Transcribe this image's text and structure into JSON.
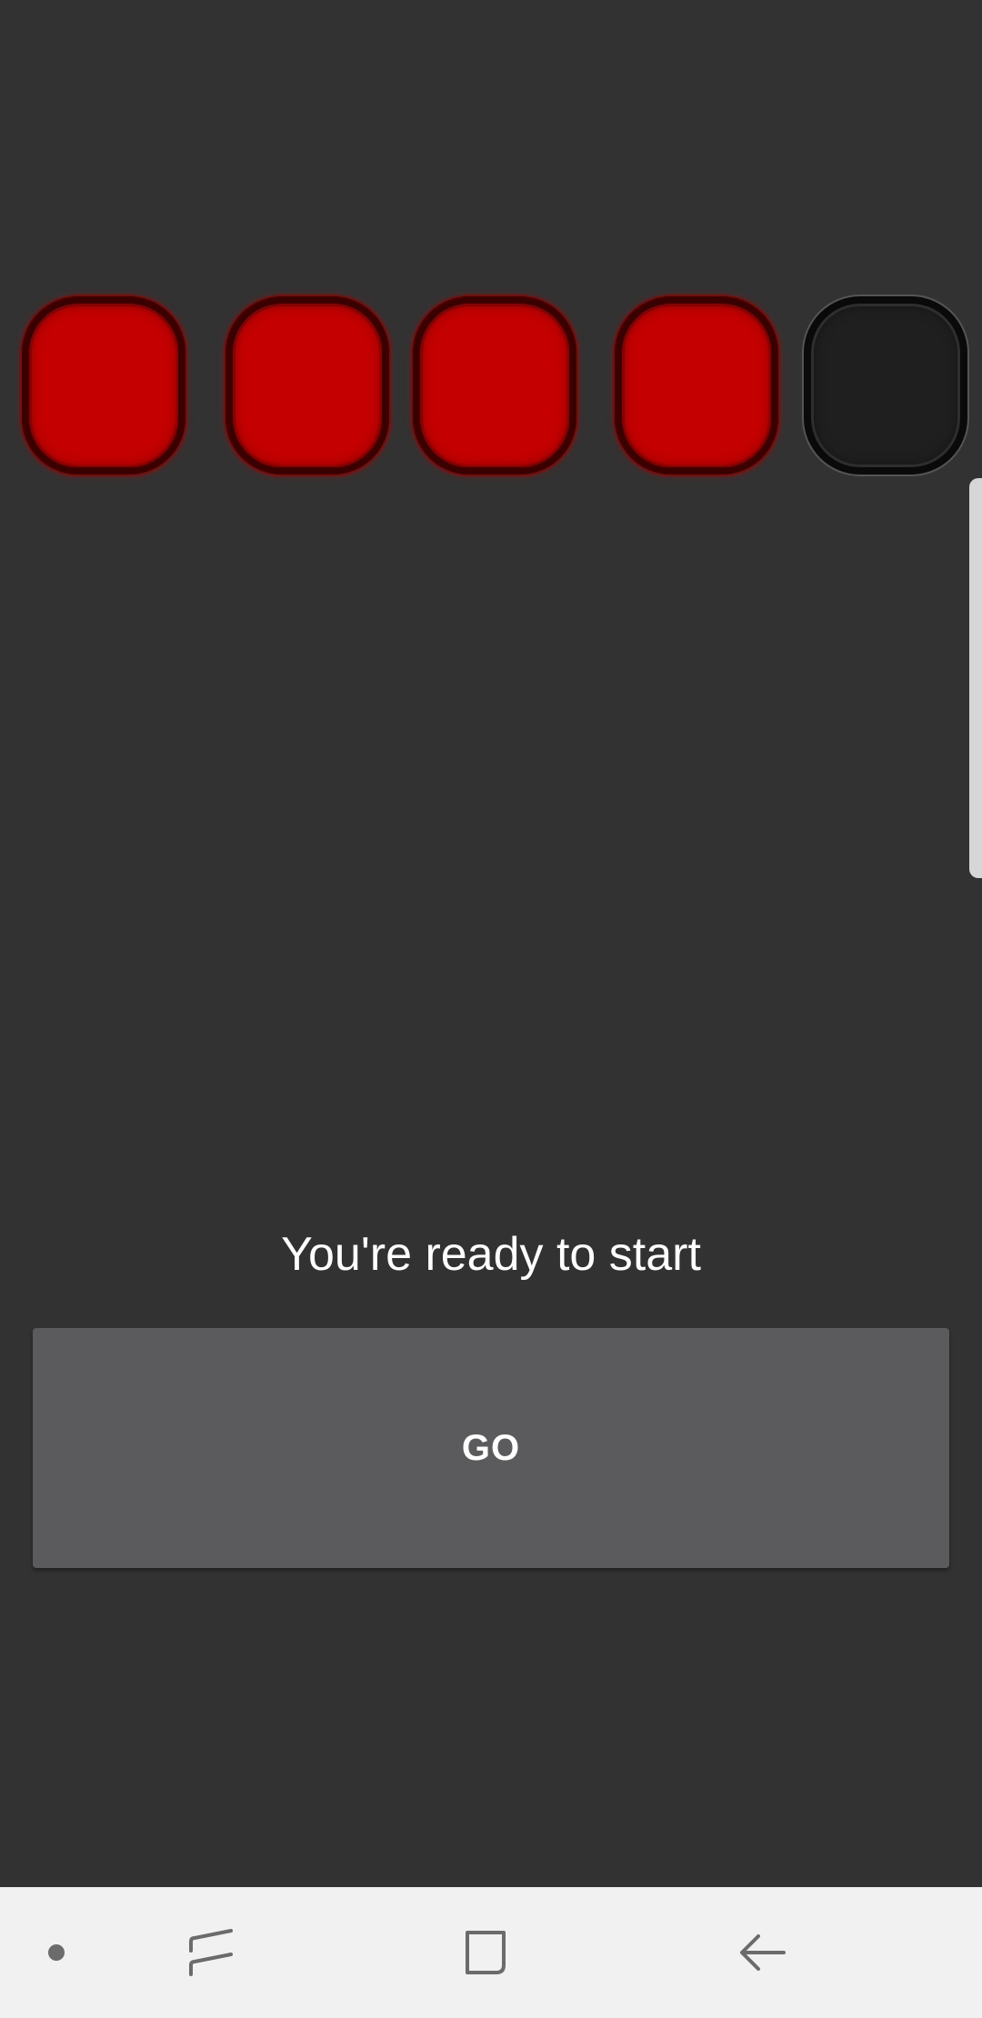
{
  "lights": [
    {
      "state": "on",
      "color": "#c40000"
    },
    {
      "state": "on",
      "color": "#c40000"
    },
    {
      "state": "on",
      "color": "#c40000"
    },
    {
      "state": "on",
      "color": "#c40000"
    },
    {
      "state": "off",
      "color": "#1f1f1f"
    }
  ],
  "status": {
    "message": "You're ready to start"
  },
  "action": {
    "go_label": "GO"
  },
  "navbar": {
    "background": "#f1f1f1",
    "icons": [
      "dot-icon",
      "recent-apps-icon",
      "home-icon",
      "back-icon"
    ]
  },
  "colors": {
    "background": "#323232",
    "button": "#5b5b5d",
    "light_on": "#c40000",
    "light_off": "#1f1f1f"
  }
}
